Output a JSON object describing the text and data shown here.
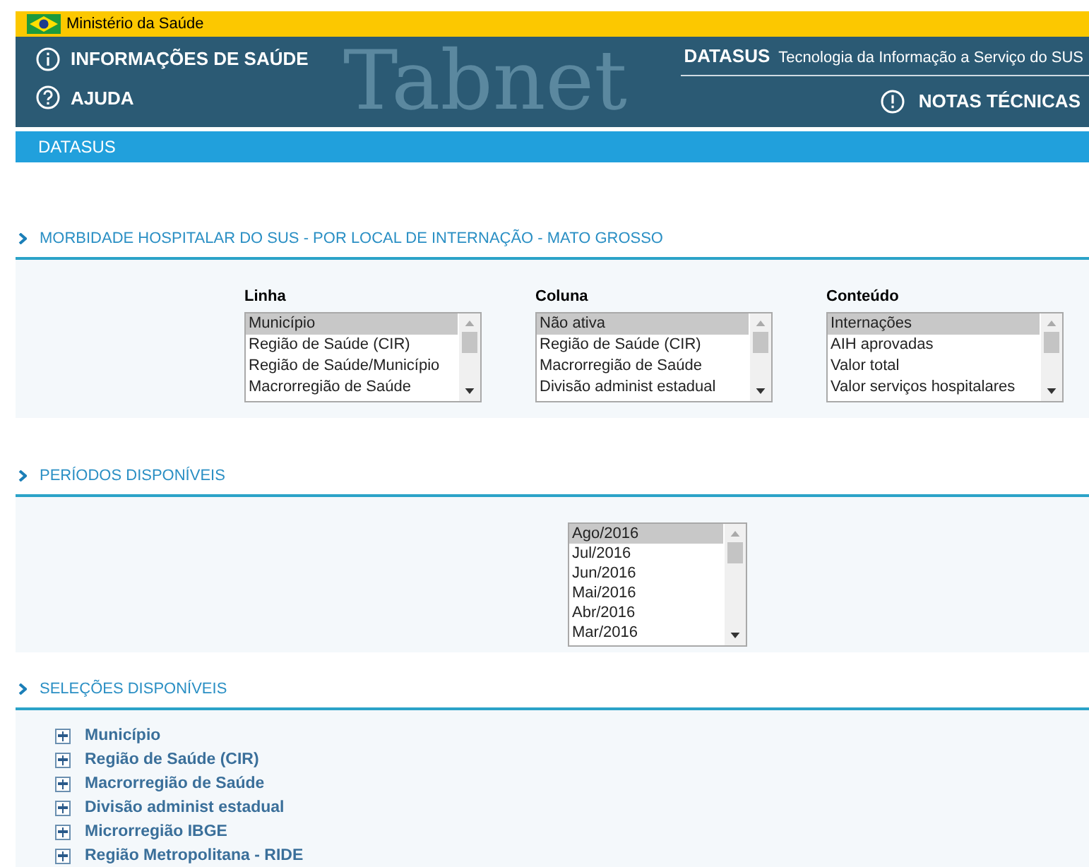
{
  "top_bar": {
    "title": "Ministério da Saúde"
  },
  "header": {
    "watermark": "Tabnet",
    "links": [
      {
        "label": "INFORMAÇÕES DE SAÚDE",
        "kind": "info"
      },
      {
        "label": "AJUDA",
        "kind": "help"
      }
    ],
    "brand": "DATASUS",
    "tagline": "Tecnologia da Informação a Serviço do SUS",
    "notes": {
      "label": "NOTAS TÉCNICAS",
      "kind": "alert"
    }
  },
  "breadcrumb": "DATASUS",
  "sections": [
    {
      "title": "MORBIDADE HOSPITALAR DO SUS - POR LOCAL DE INTERNAÇÃO - MATO GROSSO",
      "kind": "selects",
      "selects": [
        {
          "label": "Linha",
          "options": [
            {
              "label": "Município",
              "selected": true
            },
            {
              "label": "Região de Saúde (CIR)",
              "selected": false
            },
            {
              "label": "Região de Saúde/Município",
              "selected": false
            },
            {
              "label": "Macrorregião de Saúde",
              "selected": false
            }
          ]
        },
        {
          "label": "Coluna",
          "options": [
            {
              "label": "Não ativa",
              "selected": true
            },
            {
              "label": "Região de Saúde (CIR)",
              "selected": false
            },
            {
              "label": "Macrorregião de Saúde",
              "selected": false
            },
            {
              "label": "Divisão administ estadual",
              "selected": false
            }
          ]
        },
        {
          "label": "Conteúdo",
          "options": [
            {
              "label": "Internações",
              "selected": true
            },
            {
              "label": "AIH aprovadas",
              "selected": false
            },
            {
              "label": "Valor total",
              "selected": false
            },
            {
              "label": "Valor serviços hospitalares",
              "selected": false
            }
          ]
        }
      ]
    },
    {
      "title": "PERÍODOS DISPONÍVEIS",
      "kind": "periods",
      "options": [
        {
          "label": "Ago/2016",
          "selected": true
        },
        {
          "label": "Jul/2016",
          "selected": false
        },
        {
          "label": "Jun/2016",
          "selected": false
        },
        {
          "label": "Mai/2016",
          "selected": false
        },
        {
          "label": "Abr/2016",
          "selected": false
        },
        {
          "label": "Mar/2016",
          "selected": false
        }
      ]
    },
    {
      "title": "SELEÇÕES DISPONÍVEIS",
      "kind": "tree",
      "items": [
        {
          "label": "Município",
          "expanded": false
        },
        {
          "label": "Região de Saúde (CIR)",
          "expanded": false
        },
        {
          "label": "Macrorregião de Saúde",
          "expanded": false
        },
        {
          "label": "Divisão administ estadual",
          "expanded": false
        },
        {
          "label": "Microrregião IBGE",
          "expanded": false
        },
        {
          "label": "Região Metropolitana - RIDE",
          "expanded": false
        }
      ]
    }
  ]
}
